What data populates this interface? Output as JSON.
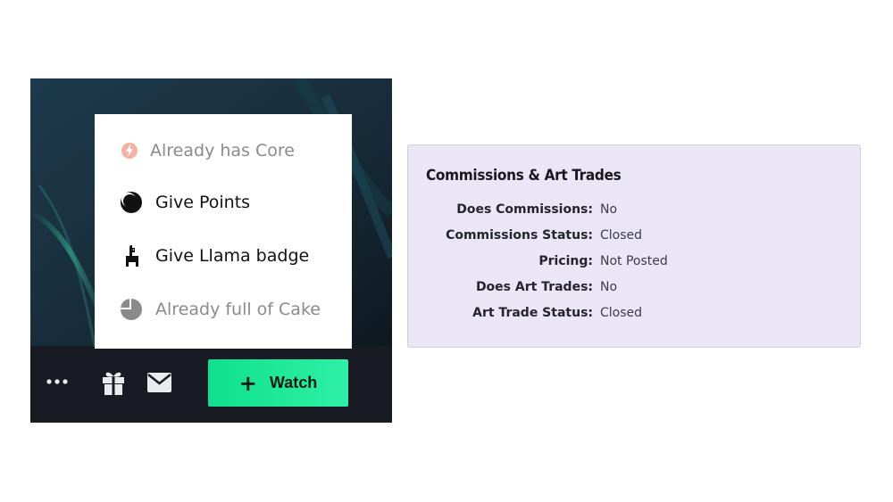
{
  "menu": {
    "items": [
      {
        "label": "Already has Core",
        "icon": "core-icon",
        "disabled": true
      },
      {
        "label": "Give Points",
        "icon": "points-icon",
        "disabled": false
      },
      {
        "label": "Give Llama badge",
        "icon": "llama-icon",
        "disabled": false
      },
      {
        "label": "Already full of Cake",
        "icon": "cake-icon",
        "disabled": true
      }
    ]
  },
  "action_bar": {
    "more_icon": "more-dots-icon",
    "gift_icon": "gift-icon",
    "mail_icon": "mail-icon",
    "watch_plus": "+",
    "watch_label": "Watch"
  },
  "commissions": {
    "title": "Commissions & Art Trades",
    "rows": [
      {
        "key": "Does Commissions:",
        "value": "No"
      },
      {
        "key": "Commissions Status:",
        "value": "Closed"
      },
      {
        "key": "Pricing:",
        "value": "Not Posted"
      },
      {
        "key": "Does Art Trades:",
        "value": "No"
      },
      {
        "key": "Art Trade Status:",
        "value": "Closed"
      }
    ]
  },
  "colors": {
    "watch_button": "#1de99b",
    "card_background": "#ebe6f6",
    "action_bar": "#181c22",
    "disabled_text": "#8a8a8a"
  }
}
